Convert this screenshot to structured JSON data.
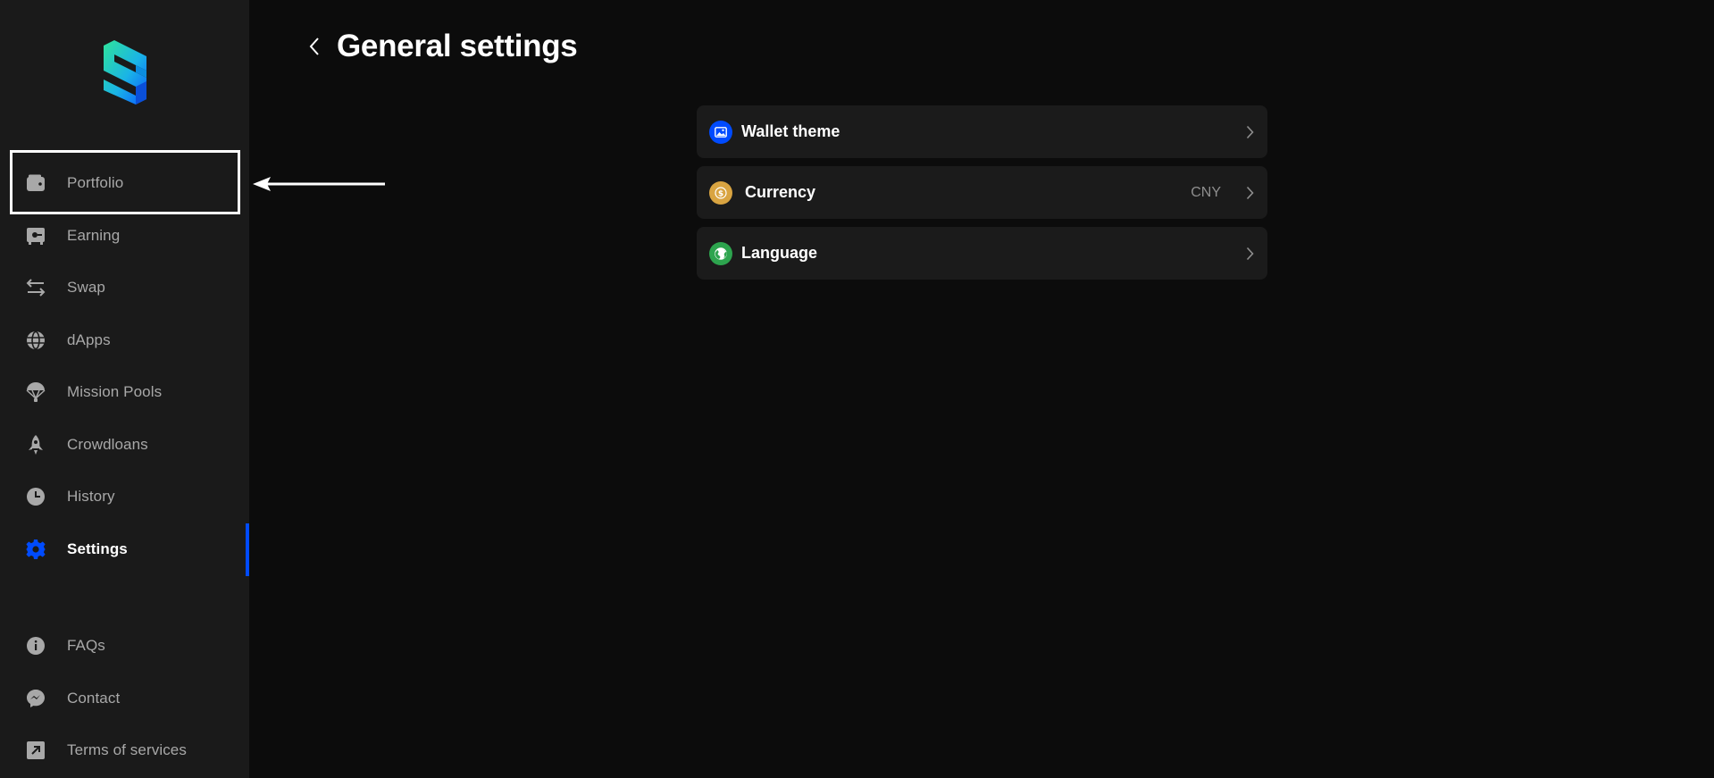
{
  "colors": {
    "sidebar_bg": "#1a1a1a",
    "page_bg": "#0c0c0c",
    "accent": "#004bff",
    "row_bg": "#1b1b1b"
  },
  "sidebar": {
    "items": [
      {
        "label": "Portfolio",
        "icon": "wallet-icon"
      },
      {
        "label": "Earning",
        "icon": "safe-icon"
      },
      {
        "label": "Swap",
        "icon": "swap-arrows-icon"
      },
      {
        "label": "dApps",
        "icon": "globe-icon"
      },
      {
        "label": "Mission Pools",
        "icon": "parachute-icon"
      },
      {
        "label": "Crowdloans",
        "icon": "rocket-icon"
      },
      {
        "label": "History",
        "icon": "clock-icon"
      },
      {
        "label": "Settings",
        "icon": "gear-icon",
        "active": true
      }
    ],
    "footer_items": [
      {
        "label": "FAQs",
        "icon": "info-icon"
      },
      {
        "label": "Contact",
        "icon": "messenger-icon"
      },
      {
        "label": "Terms of services",
        "icon": "external-link-icon"
      }
    ]
  },
  "header": {
    "title": "General settings"
  },
  "settings": {
    "rows": [
      {
        "label": "Wallet theme",
        "value": "",
        "icon": "image-icon",
        "icon_color": "#004bff"
      },
      {
        "label": "Currency",
        "value": "CNY",
        "icon": "coin-icon",
        "icon_color": "#d9a441"
      },
      {
        "label": "Language",
        "value": "",
        "icon": "globe-icon",
        "icon_color": "#2da44e"
      }
    ]
  }
}
